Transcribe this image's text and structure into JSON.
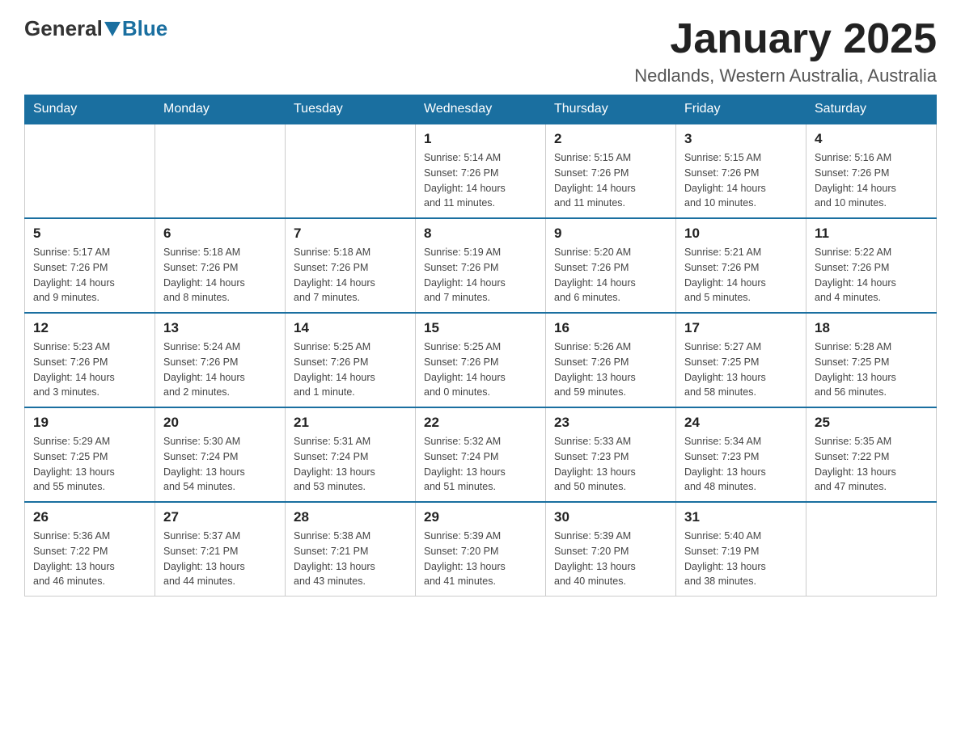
{
  "header": {
    "logo_general": "General",
    "logo_blue": "Blue",
    "month_title": "January 2025",
    "location": "Nedlands, Western Australia, Australia"
  },
  "weekdays": [
    "Sunday",
    "Monday",
    "Tuesday",
    "Wednesday",
    "Thursday",
    "Friday",
    "Saturday"
  ],
  "weeks": [
    [
      {
        "day": "",
        "info": ""
      },
      {
        "day": "",
        "info": ""
      },
      {
        "day": "",
        "info": ""
      },
      {
        "day": "1",
        "info": "Sunrise: 5:14 AM\nSunset: 7:26 PM\nDaylight: 14 hours\nand 11 minutes."
      },
      {
        "day": "2",
        "info": "Sunrise: 5:15 AM\nSunset: 7:26 PM\nDaylight: 14 hours\nand 11 minutes."
      },
      {
        "day": "3",
        "info": "Sunrise: 5:15 AM\nSunset: 7:26 PM\nDaylight: 14 hours\nand 10 minutes."
      },
      {
        "day": "4",
        "info": "Sunrise: 5:16 AM\nSunset: 7:26 PM\nDaylight: 14 hours\nand 10 minutes."
      }
    ],
    [
      {
        "day": "5",
        "info": "Sunrise: 5:17 AM\nSunset: 7:26 PM\nDaylight: 14 hours\nand 9 minutes."
      },
      {
        "day": "6",
        "info": "Sunrise: 5:18 AM\nSunset: 7:26 PM\nDaylight: 14 hours\nand 8 minutes."
      },
      {
        "day": "7",
        "info": "Sunrise: 5:18 AM\nSunset: 7:26 PM\nDaylight: 14 hours\nand 7 minutes."
      },
      {
        "day": "8",
        "info": "Sunrise: 5:19 AM\nSunset: 7:26 PM\nDaylight: 14 hours\nand 7 minutes."
      },
      {
        "day": "9",
        "info": "Sunrise: 5:20 AM\nSunset: 7:26 PM\nDaylight: 14 hours\nand 6 minutes."
      },
      {
        "day": "10",
        "info": "Sunrise: 5:21 AM\nSunset: 7:26 PM\nDaylight: 14 hours\nand 5 minutes."
      },
      {
        "day": "11",
        "info": "Sunrise: 5:22 AM\nSunset: 7:26 PM\nDaylight: 14 hours\nand 4 minutes."
      }
    ],
    [
      {
        "day": "12",
        "info": "Sunrise: 5:23 AM\nSunset: 7:26 PM\nDaylight: 14 hours\nand 3 minutes."
      },
      {
        "day": "13",
        "info": "Sunrise: 5:24 AM\nSunset: 7:26 PM\nDaylight: 14 hours\nand 2 minutes."
      },
      {
        "day": "14",
        "info": "Sunrise: 5:25 AM\nSunset: 7:26 PM\nDaylight: 14 hours\nand 1 minute."
      },
      {
        "day": "15",
        "info": "Sunrise: 5:25 AM\nSunset: 7:26 PM\nDaylight: 14 hours\nand 0 minutes."
      },
      {
        "day": "16",
        "info": "Sunrise: 5:26 AM\nSunset: 7:26 PM\nDaylight: 13 hours\nand 59 minutes."
      },
      {
        "day": "17",
        "info": "Sunrise: 5:27 AM\nSunset: 7:25 PM\nDaylight: 13 hours\nand 58 minutes."
      },
      {
        "day": "18",
        "info": "Sunrise: 5:28 AM\nSunset: 7:25 PM\nDaylight: 13 hours\nand 56 minutes."
      }
    ],
    [
      {
        "day": "19",
        "info": "Sunrise: 5:29 AM\nSunset: 7:25 PM\nDaylight: 13 hours\nand 55 minutes."
      },
      {
        "day": "20",
        "info": "Sunrise: 5:30 AM\nSunset: 7:24 PM\nDaylight: 13 hours\nand 54 minutes."
      },
      {
        "day": "21",
        "info": "Sunrise: 5:31 AM\nSunset: 7:24 PM\nDaylight: 13 hours\nand 53 minutes."
      },
      {
        "day": "22",
        "info": "Sunrise: 5:32 AM\nSunset: 7:24 PM\nDaylight: 13 hours\nand 51 minutes."
      },
      {
        "day": "23",
        "info": "Sunrise: 5:33 AM\nSunset: 7:23 PM\nDaylight: 13 hours\nand 50 minutes."
      },
      {
        "day": "24",
        "info": "Sunrise: 5:34 AM\nSunset: 7:23 PM\nDaylight: 13 hours\nand 48 minutes."
      },
      {
        "day": "25",
        "info": "Sunrise: 5:35 AM\nSunset: 7:22 PM\nDaylight: 13 hours\nand 47 minutes."
      }
    ],
    [
      {
        "day": "26",
        "info": "Sunrise: 5:36 AM\nSunset: 7:22 PM\nDaylight: 13 hours\nand 46 minutes."
      },
      {
        "day": "27",
        "info": "Sunrise: 5:37 AM\nSunset: 7:21 PM\nDaylight: 13 hours\nand 44 minutes."
      },
      {
        "day": "28",
        "info": "Sunrise: 5:38 AM\nSunset: 7:21 PM\nDaylight: 13 hours\nand 43 minutes."
      },
      {
        "day": "29",
        "info": "Sunrise: 5:39 AM\nSunset: 7:20 PM\nDaylight: 13 hours\nand 41 minutes."
      },
      {
        "day": "30",
        "info": "Sunrise: 5:39 AM\nSunset: 7:20 PM\nDaylight: 13 hours\nand 40 minutes."
      },
      {
        "day": "31",
        "info": "Sunrise: 5:40 AM\nSunset: 7:19 PM\nDaylight: 13 hours\nand 38 minutes."
      },
      {
        "day": "",
        "info": ""
      }
    ]
  ]
}
